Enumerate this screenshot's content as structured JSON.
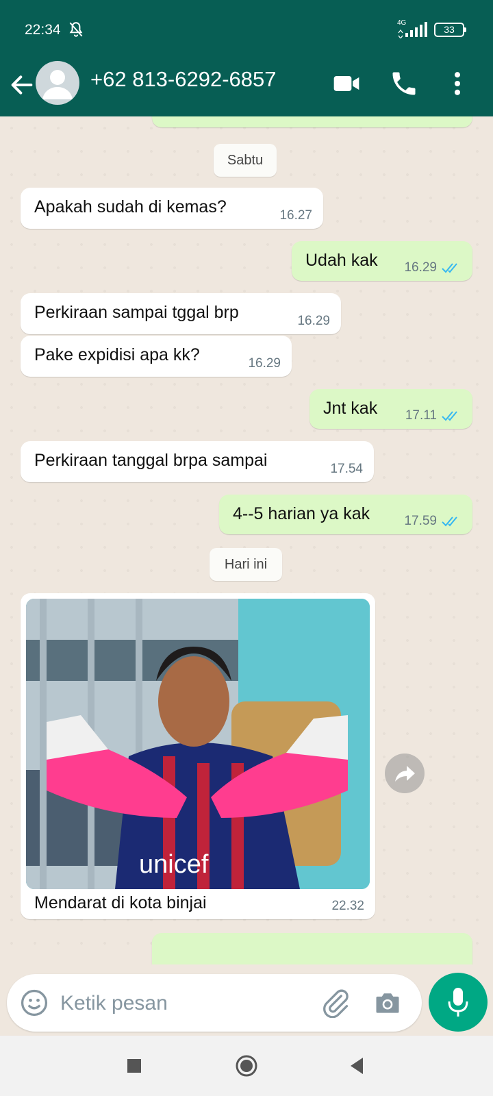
{
  "status": {
    "time": "22:34",
    "network": "4G",
    "battery": "33"
  },
  "header": {
    "contact": "+62 813-6292-6857"
  },
  "chat": {
    "day1": "Sabtu",
    "m1": {
      "text": "Apakah sudah di kemas?",
      "time": "16.27"
    },
    "m2": {
      "text": "Udah kak",
      "time": "16.29"
    },
    "m3": {
      "text": "Perkiraan sampai tggal brp",
      "time": "16.29"
    },
    "m4": {
      "text": "Pake expidisi apa kk?",
      "time": "16.29"
    },
    "m5": {
      "text": "Jnt kak",
      "time": "17.11"
    },
    "m6": {
      "text": "Perkiraan tanggal brpa sampai",
      "time": "17.54"
    },
    "m7": {
      "text": "4--5 harian ya kak",
      "time": "17.59"
    },
    "day2": "Hari ini",
    "m8": {
      "caption": "Mendarat di kota binjai",
      "time": "22.32",
      "photo_text": "unicef"
    }
  },
  "input": {
    "placeholder": "Ketik pesan"
  },
  "colors": {
    "header": "#075e54",
    "outgoing": "#dcf8c6",
    "incoming": "#ffffff",
    "accent": "#00a884",
    "read_ticks": "#34b7f1"
  },
  "icons": [
    "back-arrow-icon",
    "avatar-icon",
    "video-call-icon",
    "phone-icon",
    "more-vert-icon",
    "bell-off-icon",
    "forward-icon",
    "emoji-icon",
    "attach-icon",
    "camera-icon",
    "mic-icon",
    "nav-recents-icon",
    "nav-home-icon",
    "nav-back-icon"
  ]
}
